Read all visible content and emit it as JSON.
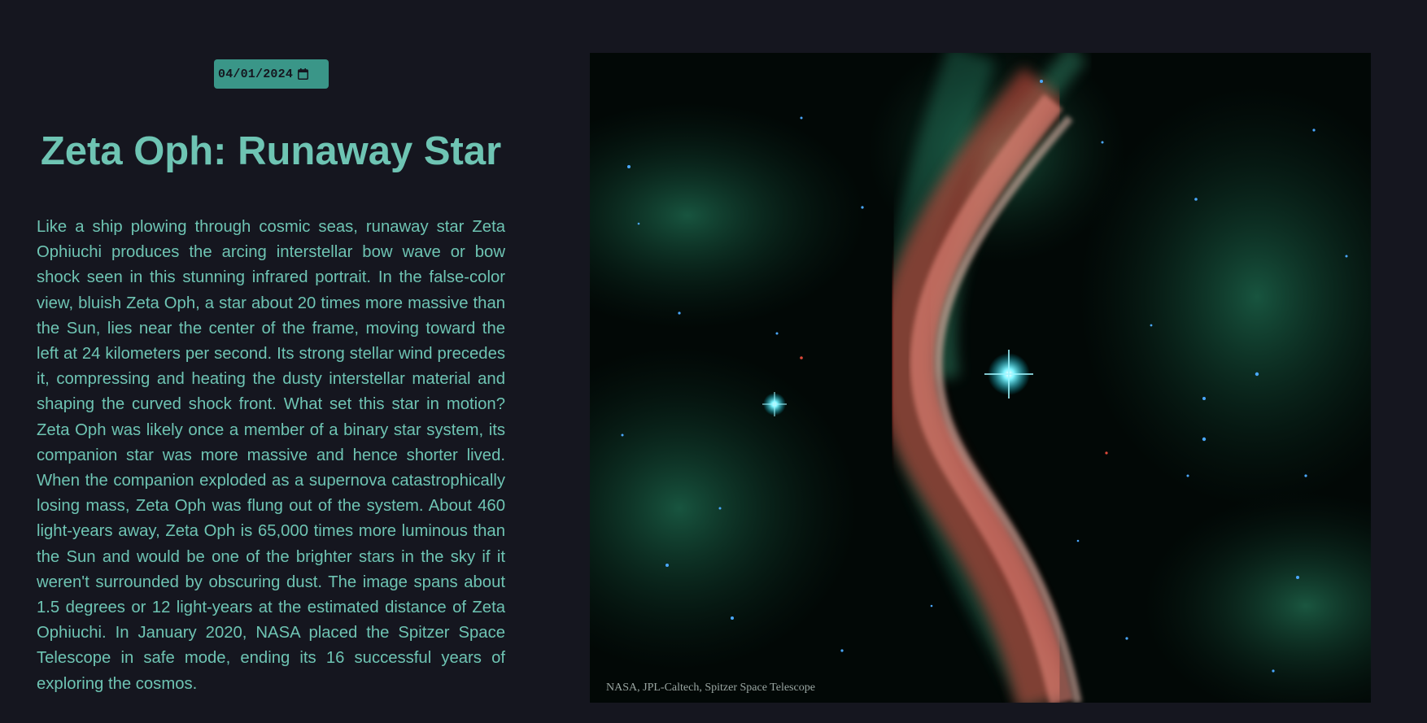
{
  "date_picker": {
    "value": "04/01/2024",
    "icon": "calendar-icon"
  },
  "apod": {
    "title": "Zeta Oph: Runaway Star",
    "explanation": "Like a ship plowing through cosmic seas, runaway star Zeta Ophiuchi produces the arcing interstellar bow wave or bow shock seen in this stunning infrared portrait. In the false-color view, bluish Zeta Oph, a star about 20 times more massive than the Sun, lies near the center of the frame, moving toward the left at 24 kilometers per second. Its strong stellar wind precedes it, compressing and heating the dusty interstellar material and shaping the curved shock front. What set this star in motion? Zeta Oph was likely once a member of a binary star system, its companion star was more massive and hence shorter lived. When the companion exploded as a supernova catastrophically losing mass, Zeta Oph was flung out of the system. About 460 light-years away, Zeta Oph is 65,000 times more luminous than the Sun and would be one of the brighter stars in the sky if it weren't surrounded by obscuring dust. The image spans about 1.5 degrees or 12 light-years at the estimated distance of Zeta Ophiuchi. In January 2020, NASA placed the Spitzer Space Telescope in safe mode, ending its 16 successful years of exploring the cosmos.",
    "image_credit": "NASA, JPL-Caltech, Spitzer Space Telescope"
  },
  "colors": {
    "background": "#15161f",
    "accent_text": "#6ec4b3",
    "date_input_bg": "#3a9688"
  }
}
